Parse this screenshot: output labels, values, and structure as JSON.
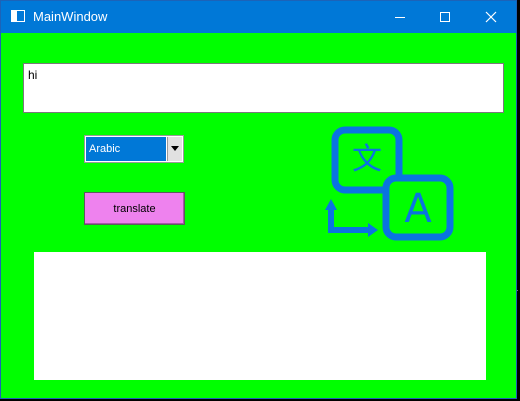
{
  "window": {
    "title": "MainWindow",
    "icons": {
      "app": "window-icon",
      "minimize": "minimize-icon",
      "maximize": "maximize-icon",
      "close": "close-icon"
    }
  },
  "input": {
    "value": "hi"
  },
  "language_select": {
    "selected": "Arabic",
    "arrow_icon": "chevron-down-icon"
  },
  "translate_button": {
    "label": "translate"
  },
  "illustration": {
    "icon": "translate-icon",
    "glyph_top": "文",
    "glyph_bottom": "A",
    "color": "#0a74e0"
  },
  "output": {
    "value": ""
  },
  "colors": {
    "window_background": "#00ff00",
    "titlebar": "#0078d7",
    "button": "#ee82ee",
    "accent": "#0078d7"
  }
}
